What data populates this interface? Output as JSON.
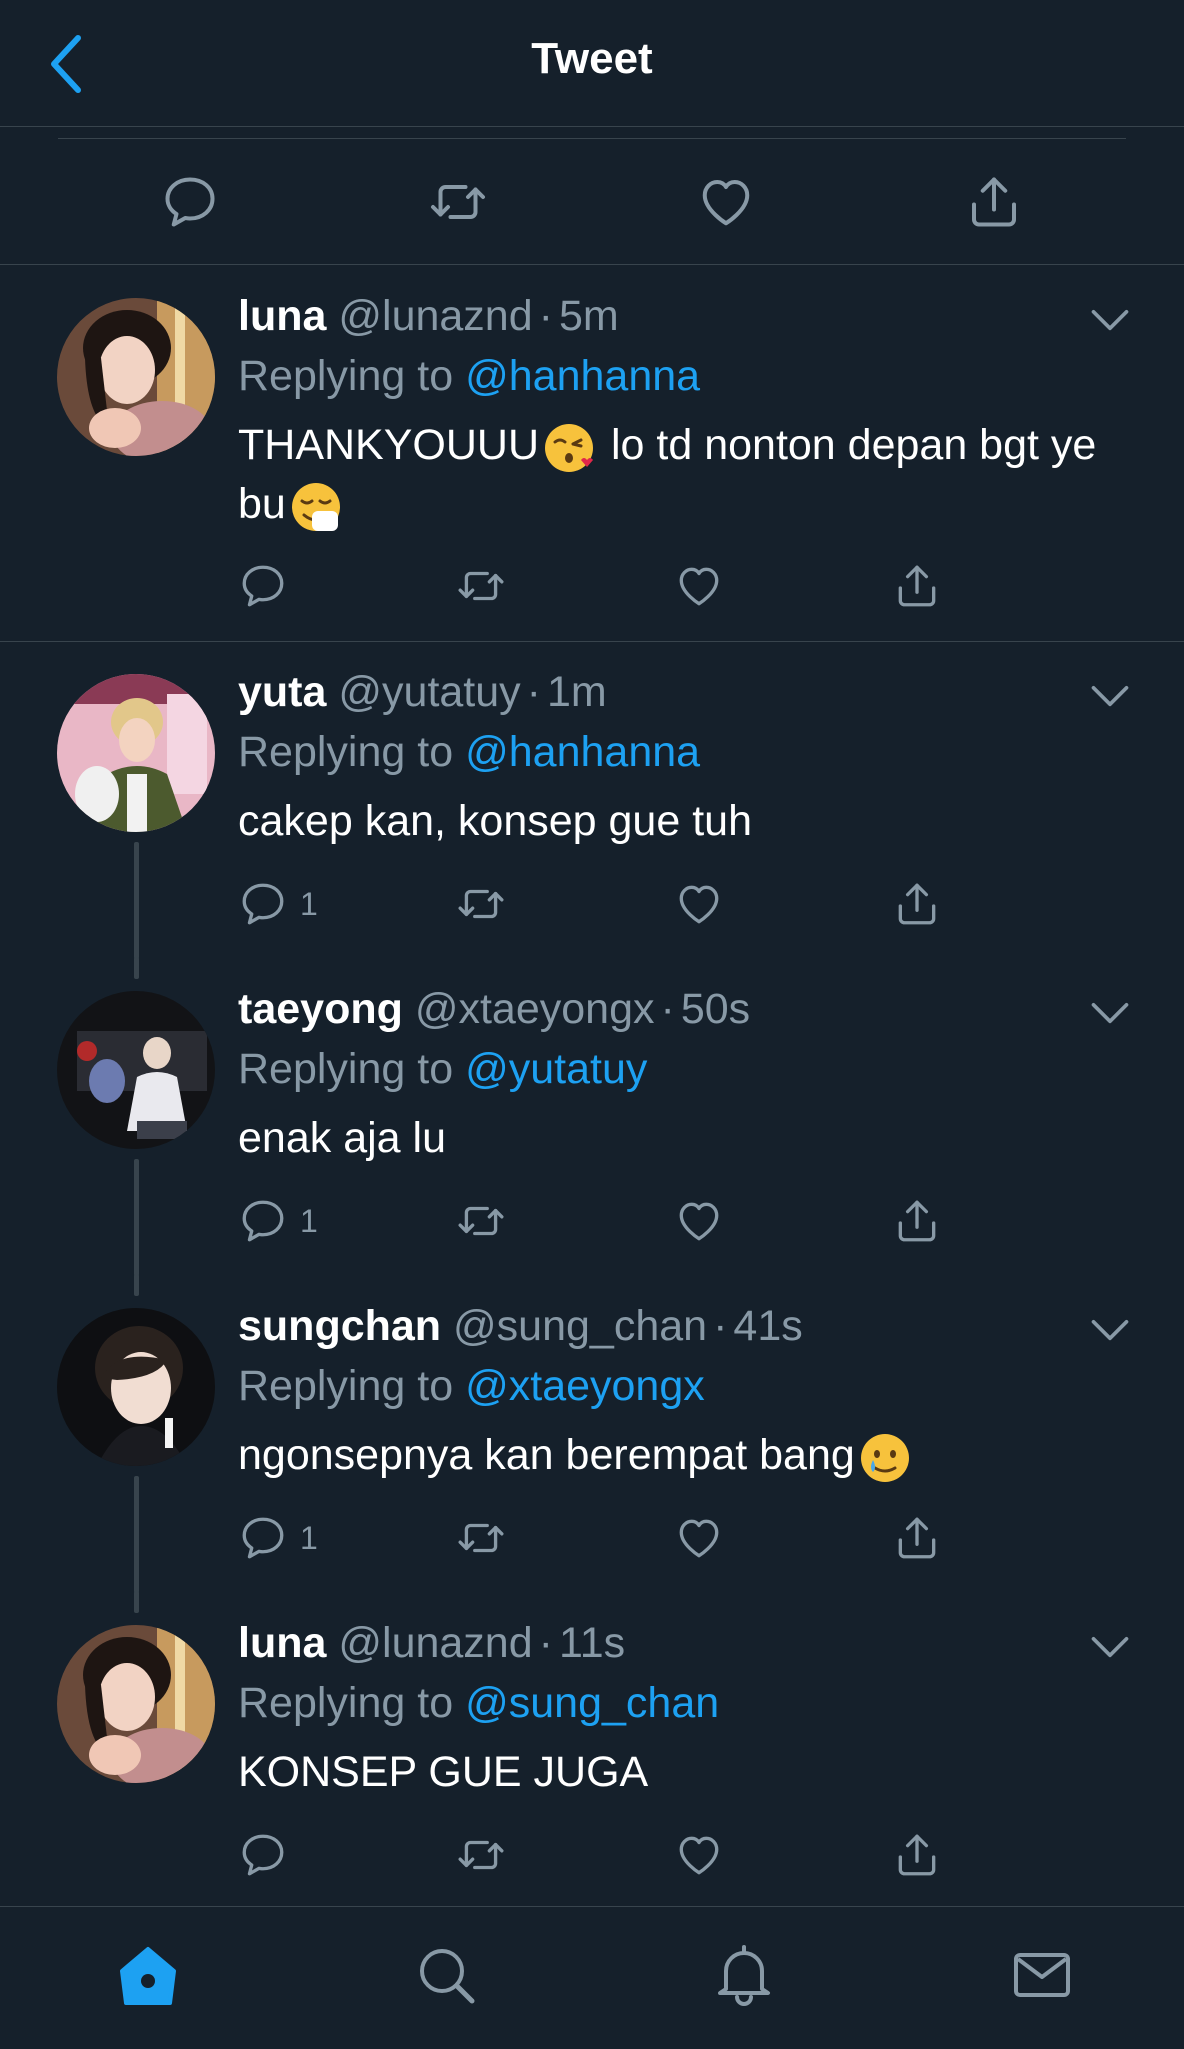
{
  "header": {
    "title": "Tweet"
  },
  "colors": {
    "background": "#15202b",
    "accent": "#1da1f2",
    "muted": "#8899a6",
    "divider": "#38444d"
  },
  "main_actions": [
    "reply-icon",
    "retweet-icon",
    "like-icon",
    "share-icon"
  ],
  "tweets": [
    {
      "name": "luna",
      "handle": "@lunaznd",
      "sep": "·",
      "time": "5m",
      "replying_label": "Replying to",
      "replying_to": "@hanhanna",
      "text_a": "THANKYOUUU",
      "text_b": " lo td nonton depan bgt ye bu",
      "reply_count": ""
    },
    {
      "name": "yuta",
      "handle": "@yutatuy",
      "sep": "·",
      "time": "1m",
      "replying_label": "Replying to",
      "replying_to": "@hanhanna",
      "text": "cakep kan, konsep gue tuh",
      "reply_count": "1"
    },
    {
      "name": "taeyong",
      "handle": "@xtaeyongx",
      "sep": "·",
      "time": "50s",
      "replying_label": "Replying to",
      "replying_to": "@yutatuy",
      "text": "enak aja lu",
      "reply_count": "1"
    },
    {
      "name": "sungchan",
      "handle": "@sung_chan",
      "sep": "·",
      "time": "41s",
      "replying_label": "Replying to",
      "replying_to": "@xtaeyongx",
      "text": "ngonsepnya kan berempat bang",
      "reply_count": "1"
    },
    {
      "name": "luna",
      "handle": "@lunaznd",
      "sep": "·",
      "time": "11s",
      "replying_label": "Replying to",
      "replying_to": "@sung_chan",
      "text": "KONSEP GUE JUGA",
      "reply_count": ""
    }
  ],
  "tabbar": [
    "home-icon",
    "search-icon",
    "notifications-icon",
    "messages-icon"
  ]
}
